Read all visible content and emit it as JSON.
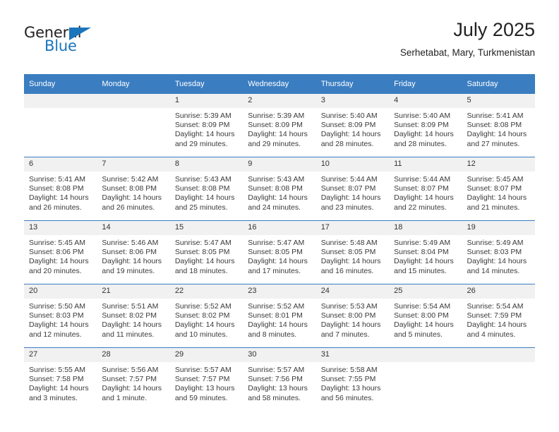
{
  "brand": {
    "name_part1": "General",
    "name_part2": "Blue",
    "accent_color": "#1b75bb"
  },
  "header": {
    "title": "July 2025",
    "subtitle": "Serhetabat, Mary, Turkmenistan"
  },
  "theme": {
    "header_blue": "#3a7dc1",
    "daynum_band": "#f1f1f1",
    "text": "#3a3a3a"
  },
  "calendar": {
    "weekday_headers": [
      "Sunday",
      "Monday",
      "Tuesday",
      "Wednesday",
      "Thursday",
      "Friday",
      "Saturday"
    ],
    "labels": {
      "sunrise": "Sunrise:",
      "sunset": "Sunset:",
      "daylight": "Daylight:"
    },
    "weeks": [
      [
        {
          "day": "",
          "sunrise": "",
          "sunset": "",
          "daylight_1": "",
          "daylight_2": ""
        },
        {
          "day": "",
          "sunrise": "",
          "sunset": "",
          "daylight_1": "",
          "daylight_2": ""
        },
        {
          "day": "1",
          "sunrise": "Sunrise: 5:39 AM",
          "sunset": "Sunset: 8:09 PM",
          "daylight_1": "Daylight: 14 hours",
          "daylight_2": "and 29 minutes."
        },
        {
          "day": "2",
          "sunrise": "Sunrise: 5:39 AM",
          "sunset": "Sunset: 8:09 PM",
          "daylight_1": "Daylight: 14 hours",
          "daylight_2": "and 29 minutes."
        },
        {
          "day": "3",
          "sunrise": "Sunrise: 5:40 AM",
          "sunset": "Sunset: 8:09 PM",
          "daylight_1": "Daylight: 14 hours",
          "daylight_2": "and 28 minutes."
        },
        {
          "day": "4",
          "sunrise": "Sunrise: 5:40 AM",
          "sunset": "Sunset: 8:09 PM",
          "daylight_1": "Daylight: 14 hours",
          "daylight_2": "and 28 minutes."
        },
        {
          "day": "5",
          "sunrise": "Sunrise: 5:41 AM",
          "sunset": "Sunset: 8:08 PM",
          "daylight_1": "Daylight: 14 hours",
          "daylight_2": "and 27 minutes."
        }
      ],
      [
        {
          "day": "6",
          "sunrise": "Sunrise: 5:41 AM",
          "sunset": "Sunset: 8:08 PM",
          "daylight_1": "Daylight: 14 hours",
          "daylight_2": "and 26 minutes."
        },
        {
          "day": "7",
          "sunrise": "Sunrise: 5:42 AM",
          "sunset": "Sunset: 8:08 PM",
          "daylight_1": "Daylight: 14 hours",
          "daylight_2": "and 26 minutes."
        },
        {
          "day": "8",
          "sunrise": "Sunrise: 5:43 AM",
          "sunset": "Sunset: 8:08 PM",
          "daylight_1": "Daylight: 14 hours",
          "daylight_2": "and 25 minutes."
        },
        {
          "day": "9",
          "sunrise": "Sunrise: 5:43 AM",
          "sunset": "Sunset: 8:08 PM",
          "daylight_1": "Daylight: 14 hours",
          "daylight_2": "and 24 minutes."
        },
        {
          "day": "10",
          "sunrise": "Sunrise: 5:44 AM",
          "sunset": "Sunset: 8:07 PM",
          "daylight_1": "Daylight: 14 hours",
          "daylight_2": "and 23 minutes."
        },
        {
          "day": "11",
          "sunrise": "Sunrise: 5:44 AM",
          "sunset": "Sunset: 8:07 PM",
          "daylight_1": "Daylight: 14 hours",
          "daylight_2": "and 22 minutes."
        },
        {
          "day": "12",
          "sunrise": "Sunrise: 5:45 AM",
          "sunset": "Sunset: 8:07 PM",
          "daylight_1": "Daylight: 14 hours",
          "daylight_2": "and 21 minutes."
        }
      ],
      [
        {
          "day": "13",
          "sunrise": "Sunrise: 5:45 AM",
          "sunset": "Sunset: 8:06 PM",
          "daylight_1": "Daylight: 14 hours",
          "daylight_2": "and 20 minutes."
        },
        {
          "day": "14",
          "sunrise": "Sunrise: 5:46 AM",
          "sunset": "Sunset: 8:06 PM",
          "daylight_1": "Daylight: 14 hours",
          "daylight_2": "and 19 minutes."
        },
        {
          "day": "15",
          "sunrise": "Sunrise: 5:47 AM",
          "sunset": "Sunset: 8:05 PM",
          "daylight_1": "Daylight: 14 hours",
          "daylight_2": "and 18 minutes."
        },
        {
          "day": "16",
          "sunrise": "Sunrise: 5:47 AM",
          "sunset": "Sunset: 8:05 PM",
          "daylight_1": "Daylight: 14 hours",
          "daylight_2": "and 17 minutes."
        },
        {
          "day": "17",
          "sunrise": "Sunrise: 5:48 AM",
          "sunset": "Sunset: 8:05 PM",
          "daylight_1": "Daylight: 14 hours",
          "daylight_2": "and 16 minutes."
        },
        {
          "day": "18",
          "sunrise": "Sunrise: 5:49 AM",
          "sunset": "Sunset: 8:04 PM",
          "daylight_1": "Daylight: 14 hours",
          "daylight_2": "and 15 minutes."
        },
        {
          "day": "19",
          "sunrise": "Sunrise: 5:49 AM",
          "sunset": "Sunset: 8:03 PM",
          "daylight_1": "Daylight: 14 hours",
          "daylight_2": "and 14 minutes."
        }
      ],
      [
        {
          "day": "20",
          "sunrise": "Sunrise: 5:50 AM",
          "sunset": "Sunset: 8:03 PM",
          "daylight_1": "Daylight: 14 hours",
          "daylight_2": "and 12 minutes."
        },
        {
          "day": "21",
          "sunrise": "Sunrise: 5:51 AM",
          "sunset": "Sunset: 8:02 PM",
          "daylight_1": "Daylight: 14 hours",
          "daylight_2": "and 11 minutes."
        },
        {
          "day": "22",
          "sunrise": "Sunrise: 5:52 AM",
          "sunset": "Sunset: 8:02 PM",
          "daylight_1": "Daylight: 14 hours",
          "daylight_2": "and 10 minutes."
        },
        {
          "day": "23",
          "sunrise": "Sunrise: 5:52 AM",
          "sunset": "Sunset: 8:01 PM",
          "daylight_1": "Daylight: 14 hours",
          "daylight_2": "and 8 minutes."
        },
        {
          "day": "24",
          "sunrise": "Sunrise: 5:53 AM",
          "sunset": "Sunset: 8:00 PM",
          "daylight_1": "Daylight: 14 hours",
          "daylight_2": "and 7 minutes."
        },
        {
          "day": "25",
          "sunrise": "Sunrise: 5:54 AM",
          "sunset": "Sunset: 8:00 PM",
          "daylight_1": "Daylight: 14 hours",
          "daylight_2": "and 5 minutes."
        },
        {
          "day": "26",
          "sunrise": "Sunrise: 5:54 AM",
          "sunset": "Sunset: 7:59 PM",
          "daylight_1": "Daylight: 14 hours",
          "daylight_2": "and 4 minutes."
        }
      ],
      [
        {
          "day": "27",
          "sunrise": "Sunrise: 5:55 AM",
          "sunset": "Sunset: 7:58 PM",
          "daylight_1": "Daylight: 14 hours",
          "daylight_2": "and 3 minutes."
        },
        {
          "day": "28",
          "sunrise": "Sunrise: 5:56 AM",
          "sunset": "Sunset: 7:57 PM",
          "daylight_1": "Daylight: 14 hours",
          "daylight_2": "and 1 minute."
        },
        {
          "day": "29",
          "sunrise": "Sunrise: 5:57 AM",
          "sunset": "Sunset: 7:57 PM",
          "daylight_1": "Daylight: 13 hours",
          "daylight_2": "and 59 minutes."
        },
        {
          "day": "30",
          "sunrise": "Sunrise: 5:57 AM",
          "sunset": "Sunset: 7:56 PM",
          "daylight_1": "Daylight: 13 hours",
          "daylight_2": "and 58 minutes."
        },
        {
          "day": "31",
          "sunrise": "Sunrise: 5:58 AM",
          "sunset": "Sunset: 7:55 PM",
          "daylight_1": "Daylight: 13 hours",
          "daylight_2": "and 56 minutes."
        },
        {
          "day": "",
          "sunrise": "",
          "sunset": "",
          "daylight_1": "",
          "daylight_2": ""
        },
        {
          "day": "",
          "sunrise": "",
          "sunset": "",
          "daylight_1": "",
          "daylight_2": ""
        }
      ]
    ]
  }
}
